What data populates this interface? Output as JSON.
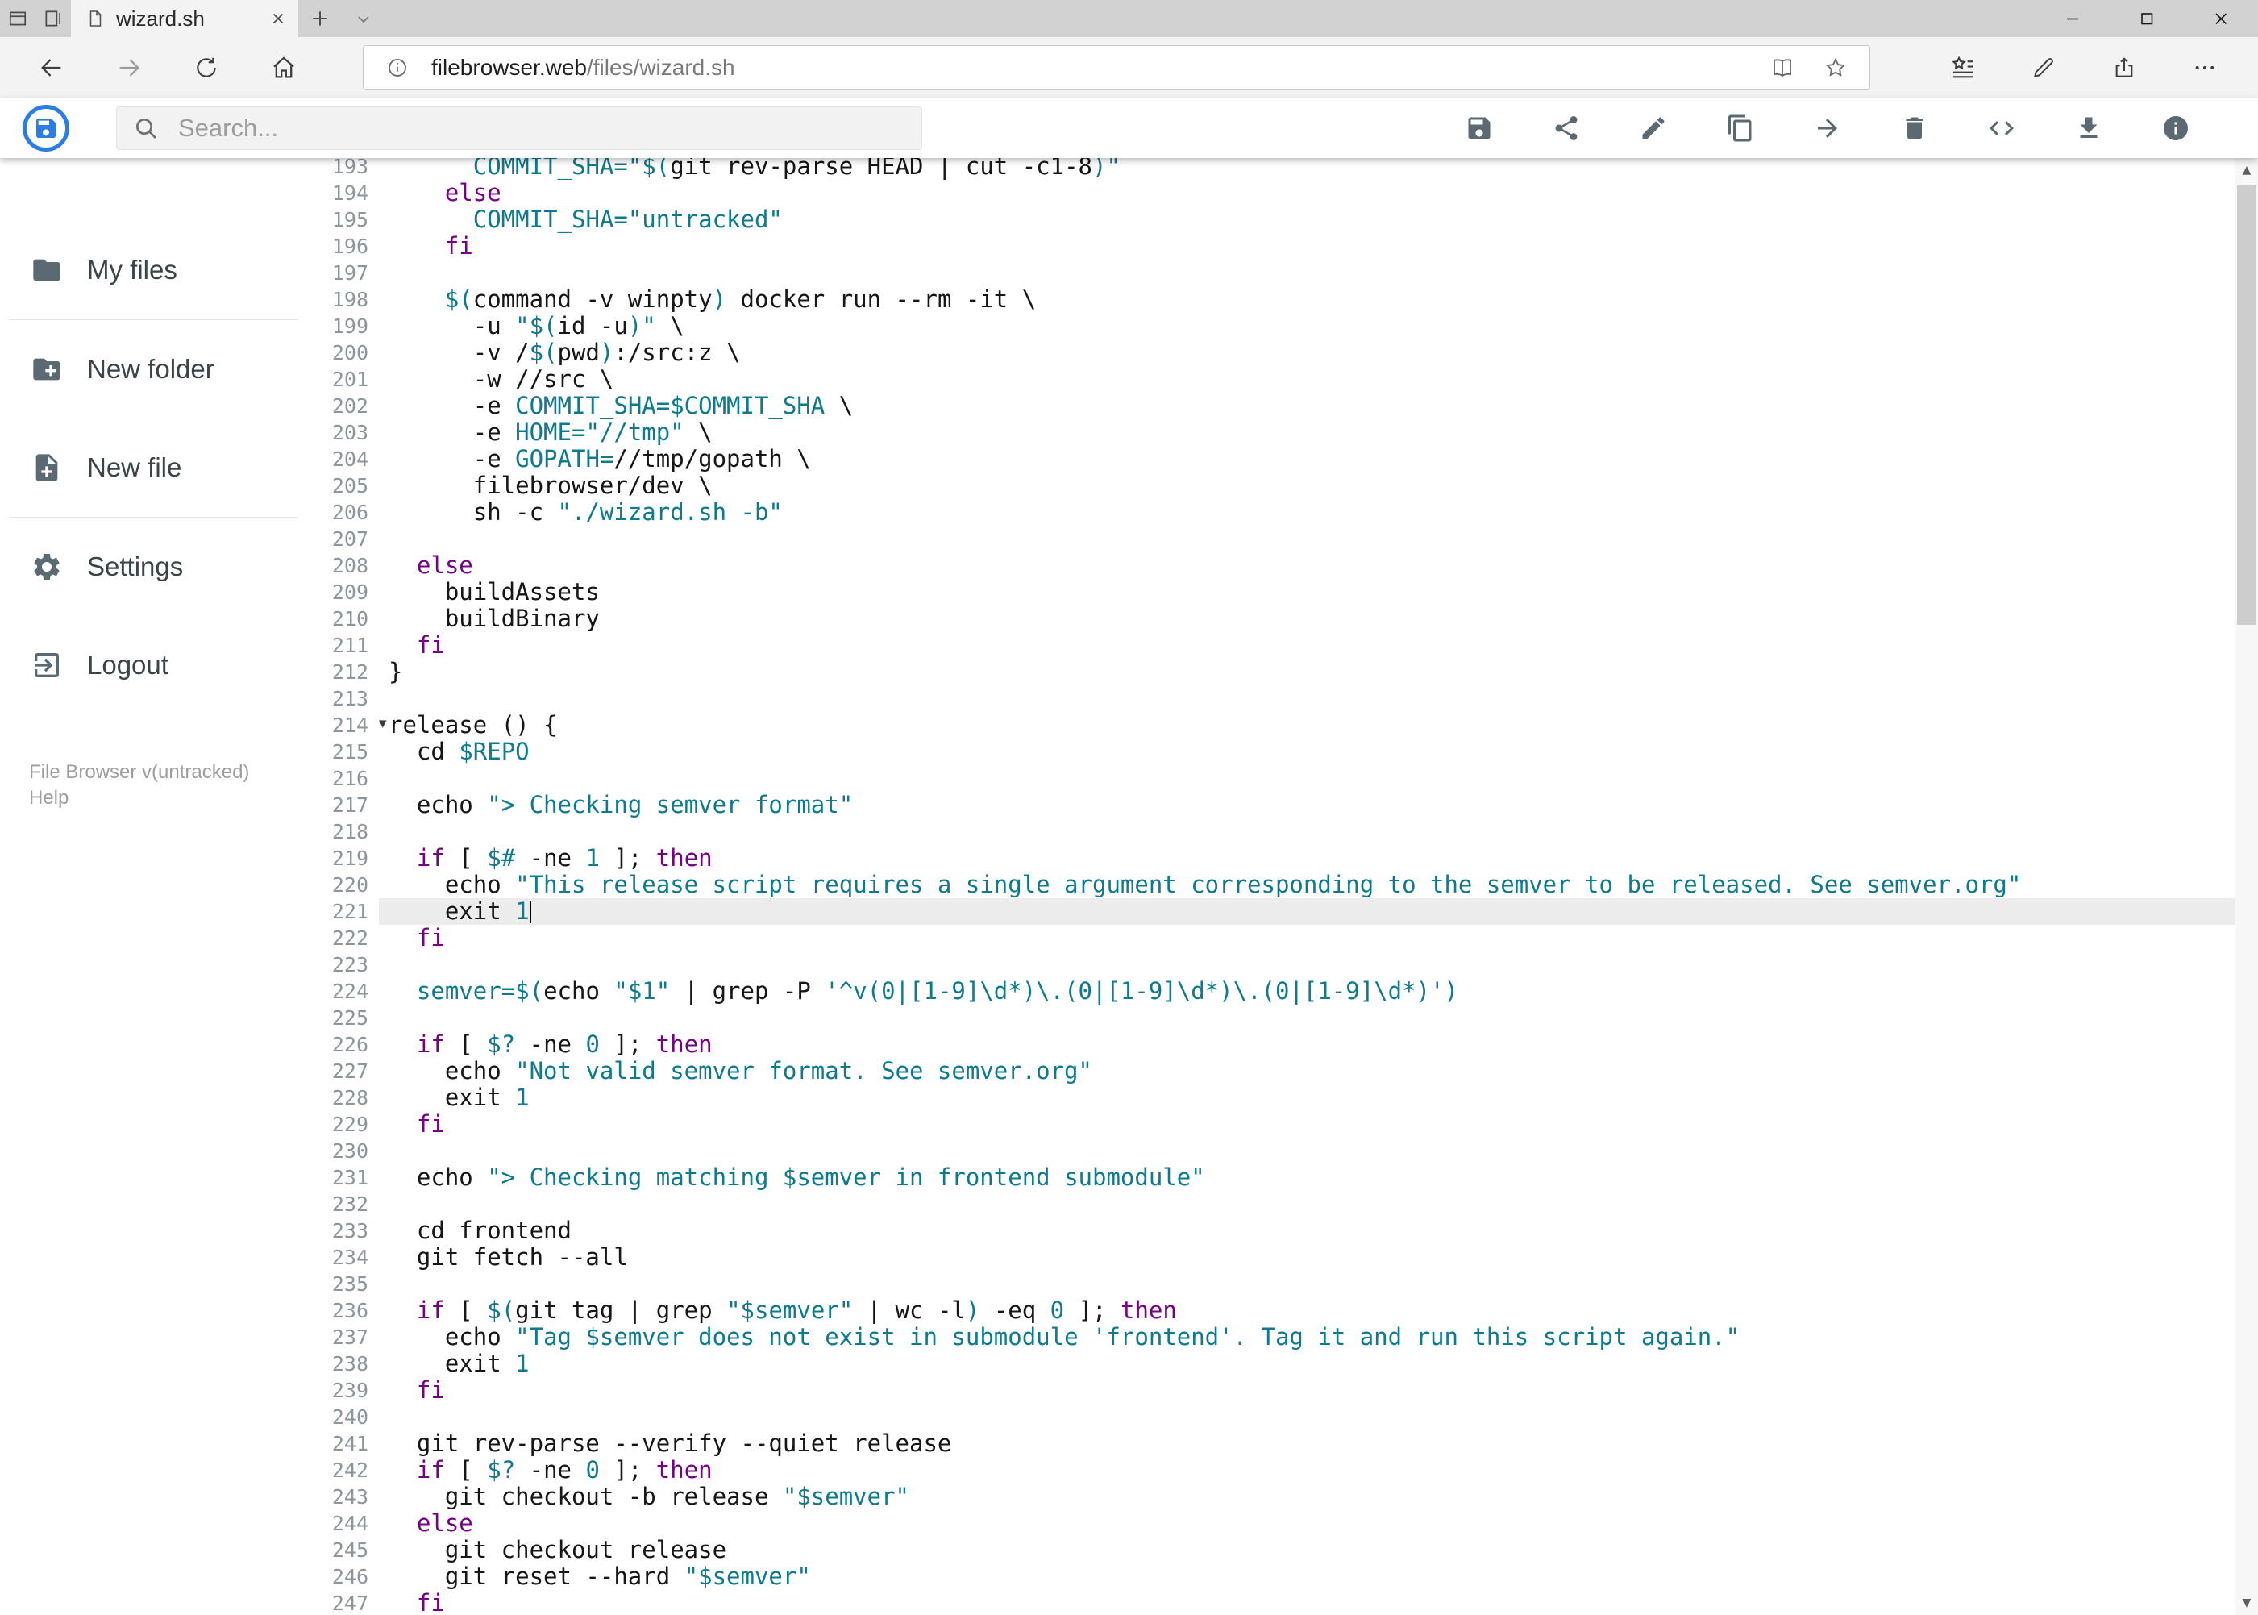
{
  "colors": {
    "accent": "#2a7de2",
    "keyword": "#770088",
    "string_teal": "#0e7a8f",
    "active_line_bg": "#ececec"
  },
  "browser": {
    "tab_title": "wizard.sh",
    "url_host": "filebrowser.web",
    "url_path": "/files/wizard.sh"
  },
  "header": {
    "search_placeholder": "Search..."
  },
  "toolbar": {
    "icons": [
      "save",
      "share",
      "rename",
      "copy",
      "move",
      "delete",
      "code",
      "download",
      "info"
    ]
  },
  "sidebar": {
    "items": [
      {
        "label": "My files"
      },
      {
        "label": "New folder"
      },
      {
        "label": "New file"
      },
      {
        "label": "Settings"
      },
      {
        "label": "Logout"
      }
    ],
    "footer": {
      "version": "File Browser v(untracked)",
      "help": "Help"
    }
  },
  "editor": {
    "active_line": 221,
    "fold_line": 214,
    "lines": [
      {
        "n": 193,
        "t": [
          [
            "p",
            "      "
          ],
          [
            "v",
            "COMMIT_SHA="
          ],
          [
            "s",
            "\"$("
          ],
          [
            "p",
            "git rev-parse HEAD | cut -c1-8"
          ],
          [
            "s",
            ")\""
          ]
        ]
      },
      {
        "n": 194,
        "t": [
          [
            "p",
            "    "
          ],
          [
            "k",
            "else"
          ]
        ]
      },
      {
        "n": 195,
        "t": [
          [
            "p",
            "      "
          ],
          [
            "v",
            "COMMIT_SHA="
          ],
          [
            "s",
            "\"untracked\""
          ]
        ]
      },
      {
        "n": 196,
        "t": [
          [
            "p",
            "    "
          ],
          [
            "k",
            "fi"
          ]
        ]
      },
      {
        "n": 197,
        "t": []
      },
      {
        "n": 198,
        "t": [
          [
            "p",
            "    "
          ],
          [
            "s",
            "$("
          ],
          [
            "p",
            "command -v winpty"
          ],
          [
            "s",
            ")"
          ],
          [
            "p",
            " docker run --rm -it \\"
          ]
        ]
      },
      {
        "n": 199,
        "t": [
          [
            "p",
            "      -u "
          ],
          [
            "s",
            "\"$("
          ],
          [
            "p",
            "id -u"
          ],
          [
            "s",
            ")\""
          ],
          [
            "p",
            " \\"
          ]
        ]
      },
      {
        "n": 200,
        "t": [
          [
            "p",
            "      -v /"
          ],
          [
            "s",
            "$("
          ],
          [
            "p",
            "pwd"
          ],
          [
            "s",
            ")"
          ],
          [
            "p",
            ":/src:z \\"
          ]
        ]
      },
      {
        "n": 201,
        "t": [
          [
            "p",
            "      -w //src \\"
          ]
        ]
      },
      {
        "n": 202,
        "t": [
          [
            "p",
            "      -e "
          ],
          [
            "v",
            "COMMIT_SHA=$COMMIT_SHA"
          ],
          [
            "p",
            " \\"
          ]
        ]
      },
      {
        "n": 203,
        "t": [
          [
            "p",
            "      -e "
          ],
          [
            "v",
            "HOME="
          ],
          [
            "s",
            "\"//tmp\""
          ],
          [
            "p",
            " \\"
          ]
        ]
      },
      {
        "n": 204,
        "t": [
          [
            "p",
            "      -e "
          ],
          [
            "v",
            "GOPATH="
          ],
          [
            "p",
            "//tmp/gopath \\"
          ]
        ]
      },
      {
        "n": 205,
        "t": [
          [
            "p",
            "      filebrowser/dev \\"
          ]
        ]
      },
      {
        "n": 206,
        "t": [
          [
            "p",
            "      sh -c "
          ],
          [
            "s",
            "\"./wizard.sh -b\""
          ]
        ]
      },
      {
        "n": 207,
        "t": []
      },
      {
        "n": 208,
        "t": [
          [
            "p",
            "  "
          ],
          [
            "k",
            "else"
          ]
        ]
      },
      {
        "n": 209,
        "t": [
          [
            "p",
            "    buildAssets"
          ]
        ]
      },
      {
        "n": 210,
        "t": [
          [
            "p",
            "    buildBinary"
          ]
        ]
      },
      {
        "n": 211,
        "t": [
          [
            "p",
            "  "
          ],
          [
            "k",
            "fi"
          ]
        ]
      },
      {
        "n": 212,
        "t": [
          [
            "p",
            "}"
          ]
        ]
      },
      {
        "n": 213,
        "t": []
      },
      {
        "n": 214,
        "t": [
          [
            "p",
            "release () {"
          ]
        ]
      },
      {
        "n": 215,
        "t": [
          [
            "p",
            "  cd "
          ],
          [
            "v",
            "$REPO"
          ]
        ]
      },
      {
        "n": 216,
        "t": []
      },
      {
        "n": 217,
        "t": [
          [
            "p",
            "  echo "
          ],
          [
            "s",
            "\"> Checking semver format\""
          ]
        ]
      },
      {
        "n": 218,
        "t": []
      },
      {
        "n": 219,
        "t": [
          [
            "p",
            "  "
          ],
          [
            "k",
            "if"
          ],
          [
            "p",
            " [ "
          ],
          [
            "v",
            "$#"
          ],
          [
            "p",
            " -ne "
          ],
          [
            "v",
            "1"
          ],
          [
            "p",
            " ]; "
          ],
          [
            "k",
            "then"
          ]
        ]
      },
      {
        "n": 220,
        "t": [
          [
            "p",
            "    echo "
          ],
          [
            "s",
            "\"This release script requires a single argument corresponding to the semver to be released. See semver.org\""
          ]
        ]
      },
      {
        "n": 221,
        "t": [
          [
            "p",
            "    exit "
          ],
          [
            "v",
            "1"
          ]
        ]
      },
      {
        "n": 222,
        "t": [
          [
            "p",
            "  "
          ],
          [
            "k",
            "fi"
          ]
        ]
      },
      {
        "n": 223,
        "t": []
      },
      {
        "n": 224,
        "t": [
          [
            "p",
            "  "
          ],
          [
            "v",
            "semver="
          ],
          [
            "s",
            "$("
          ],
          [
            "p",
            "echo "
          ],
          [
            "s",
            "\"$1\""
          ],
          [
            "p",
            " | grep -P "
          ],
          [
            "s",
            "'^v(0|[1-9]\\d*)\\.(0|[1-9]\\d*)\\.(0|[1-9]\\d*)'"
          ],
          [
            "s",
            ")"
          ]
        ]
      },
      {
        "n": 225,
        "t": []
      },
      {
        "n": 226,
        "t": [
          [
            "p",
            "  "
          ],
          [
            "k",
            "if"
          ],
          [
            "p",
            " [ "
          ],
          [
            "v",
            "$?"
          ],
          [
            "p",
            " -ne "
          ],
          [
            "v",
            "0"
          ],
          [
            "p",
            " ]; "
          ],
          [
            "k",
            "then"
          ]
        ]
      },
      {
        "n": 227,
        "t": [
          [
            "p",
            "    echo "
          ],
          [
            "s",
            "\"Not valid semver format. See semver.org\""
          ]
        ]
      },
      {
        "n": 228,
        "t": [
          [
            "p",
            "    exit "
          ],
          [
            "v",
            "1"
          ]
        ]
      },
      {
        "n": 229,
        "t": [
          [
            "p",
            "  "
          ],
          [
            "k",
            "fi"
          ]
        ]
      },
      {
        "n": 230,
        "t": []
      },
      {
        "n": 231,
        "t": [
          [
            "p",
            "  echo "
          ],
          [
            "s",
            "\"> Checking matching "
          ],
          [
            "v",
            "$semver"
          ],
          [
            "s",
            " in frontend submodule\""
          ]
        ]
      },
      {
        "n": 232,
        "t": []
      },
      {
        "n": 233,
        "t": [
          [
            "p",
            "  cd frontend"
          ]
        ]
      },
      {
        "n": 234,
        "t": [
          [
            "p",
            "  git fetch --all"
          ]
        ]
      },
      {
        "n": 235,
        "t": []
      },
      {
        "n": 236,
        "t": [
          [
            "p",
            "  "
          ],
          [
            "k",
            "if"
          ],
          [
            "p",
            " [ "
          ],
          [
            "s",
            "$("
          ],
          [
            "p",
            "git tag | grep "
          ],
          [
            "s",
            "\"$semver\""
          ],
          [
            "p",
            " | wc -l"
          ],
          [
            "s",
            ")"
          ],
          [
            "p",
            " -eq "
          ],
          [
            "v",
            "0"
          ],
          [
            "p",
            " ]; "
          ],
          [
            "k",
            "then"
          ]
        ]
      },
      {
        "n": 237,
        "t": [
          [
            "p",
            "    echo "
          ],
          [
            "s",
            "\"Tag "
          ],
          [
            "v",
            "$semver"
          ],
          [
            "s",
            " does not exist in submodule 'frontend'. Tag it and run this script again.\""
          ]
        ]
      },
      {
        "n": 238,
        "t": [
          [
            "p",
            "    exit "
          ],
          [
            "v",
            "1"
          ]
        ]
      },
      {
        "n": 239,
        "t": [
          [
            "p",
            "  "
          ],
          [
            "k",
            "fi"
          ]
        ]
      },
      {
        "n": 240,
        "t": []
      },
      {
        "n": 241,
        "t": [
          [
            "p",
            "  git rev-parse --verify --quiet release"
          ]
        ]
      },
      {
        "n": 242,
        "t": [
          [
            "p",
            "  "
          ],
          [
            "k",
            "if"
          ],
          [
            "p",
            " [ "
          ],
          [
            "v",
            "$?"
          ],
          [
            "p",
            " -ne "
          ],
          [
            "v",
            "0"
          ],
          [
            "p",
            " ]; "
          ],
          [
            "k",
            "then"
          ]
        ]
      },
      {
        "n": 243,
        "t": [
          [
            "p",
            "    git checkout -b release "
          ],
          [
            "s",
            "\"$semver\""
          ]
        ]
      },
      {
        "n": 244,
        "t": [
          [
            "p",
            "  "
          ],
          [
            "k",
            "else"
          ]
        ]
      },
      {
        "n": 245,
        "t": [
          [
            "p",
            "    git checkout release"
          ]
        ]
      },
      {
        "n": 246,
        "t": [
          [
            "p",
            "    git reset --hard "
          ],
          [
            "s",
            "\"$semver\""
          ]
        ]
      },
      {
        "n": 247,
        "t": [
          [
            "p",
            "  "
          ],
          [
            "k",
            "fi"
          ]
        ]
      }
    ]
  }
}
